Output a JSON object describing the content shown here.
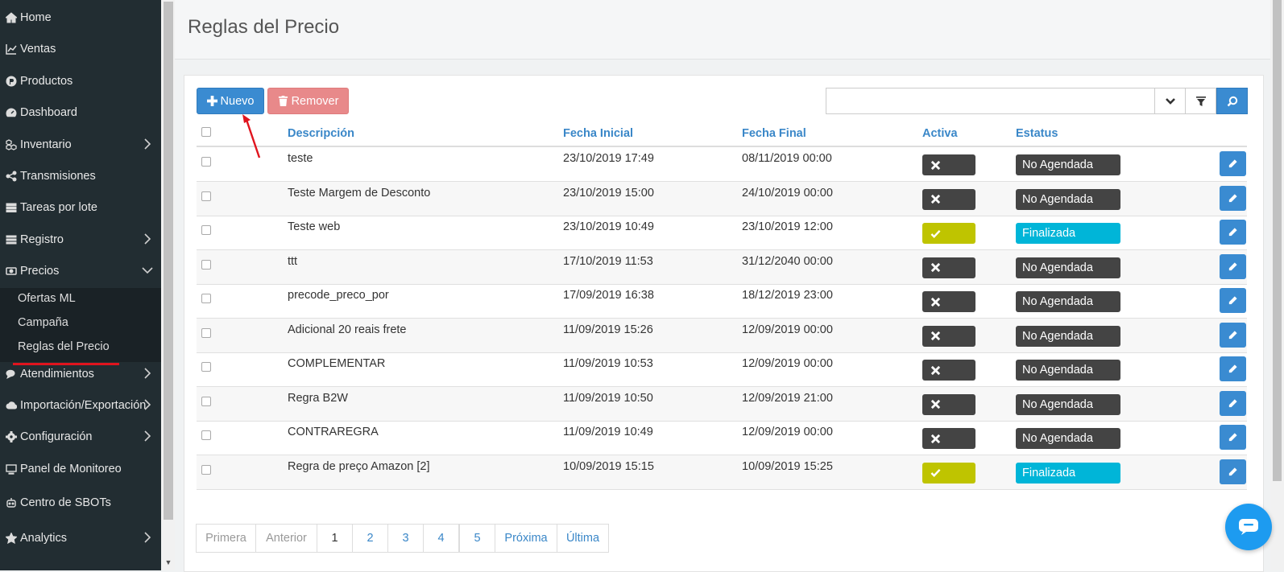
{
  "sidebar": {
    "items": [
      {
        "label": "Home",
        "icon": "home-icon",
        "chevron": false
      },
      {
        "label": "Ventas",
        "icon": "line-chart-icon",
        "chevron": false
      },
      {
        "label": "Productos",
        "icon": "product-icon",
        "chevron": false
      },
      {
        "label": "Dashboard",
        "icon": "dashboard-icon",
        "chevron": false
      },
      {
        "label": "Inventario",
        "icon": "cubes-icon",
        "chevron": true
      },
      {
        "label": "Transmisiones",
        "icon": "share-icon",
        "chevron": false
      },
      {
        "label": "Tareas por lote",
        "icon": "tasks-icon",
        "chevron": false
      },
      {
        "label": "Registro",
        "icon": "list-icon",
        "chevron": true
      },
      {
        "label": "Precios",
        "icon": "money-icon",
        "chevron": true,
        "expanded": true
      },
      {
        "label": "Atendimientos",
        "icon": "comments-icon",
        "chevron": true
      },
      {
        "label": "Importación/Exportación",
        "icon": "cloud-icon",
        "chevron": true
      },
      {
        "label": "Configuración",
        "icon": "gear-icon",
        "chevron": true
      },
      {
        "label": "Panel de Monitoreo",
        "icon": "monitor-icon",
        "chevron": false
      },
      {
        "label": "Centro de SBOTs",
        "icon": "robot-icon",
        "chevron": false
      },
      {
        "label": "Analytics",
        "icon": "star-icon",
        "chevron": true
      }
    ],
    "submenu": [
      "Ofertas ML",
      "Campaña",
      "Reglas del Precio"
    ]
  },
  "page": {
    "title": "Reglas del Precio"
  },
  "toolbar": {
    "new_label": "Nuevo",
    "remove_label": "Remover",
    "search_value": "",
    "search_placeholder": ""
  },
  "table": {
    "headers": {
      "descripcion": "Descripción",
      "fecha_inicial": "Fecha Inicial",
      "fecha_final": "Fecha Final",
      "activa": "Activa",
      "estatus": "Estatus"
    },
    "rows": [
      {
        "descripcion": "teste",
        "fecha_inicial": "23/10/2019 17:49",
        "fecha_final": "08/11/2019 00:00",
        "activa": false,
        "estatus": "No Agendada"
      },
      {
        "descripcion": "Teste Margem de Desconto",
        "fecha_inicial": "23/10/2019 15:00",
        "fecha_final": "24/10/2019 00:00",
        "activa": false,
        "estatus": "No Agendada"
      },
      {
        "descripcion": "Teste web",
        "fecha_inicial": "23/10/2019 10:49",
        "fecha_final": "23/10/2019 12:00",
        "activa": true,
        "estatus": "Finalizada"
      },
      {
        "descripcion": "ttt",
        "fecha_inicial": "17/10/2019 11:53",
        "fecha_final": "31/12/2040 00:00",
        "activa": false,
        "estatus": "No Agendada"
      },
      {
        "descripcion": "precode_preco_por",
        "fecha_inicial": "17/09/2019 16:38",
        "fecha_final": "18/12/2019 23:00",
        "activa": false,
        "estatus": "No Agendada"
      },
      {
        "descripcion": "Adicional 20 reais frete",
        "fecha_inicial": "11/09/2019 15:26",
        "fecha_final": "12/09/2019 00:00",
        "activa": false,
        "estatus": "No Agendada"
      },
      {
        "descripcion": "COMPLEMENTAR",
        "fecha_inicial": "11/09/2019 10:53",
        "fecha_final": "12/09/2019 00:00",
        "activa": false,
        "estatus": "No Agendada"
      },
      {
        "descripcion": "Regra B2W",
        "fecha_inicial": "11/09/2019 10:50",
        "fecha_final": "12/09/2019 21:00",
        "activa": false,
        "estatus": "No Agendada"
      },
      {
        "descripcion": "CONTRAREGRA",
        "fecha_inicial": "11/09/2019 10:49",
        "fecha_final": "12/09/2019 00:00",
        "activa": false,
        "estatus": "No Agendada"
      },
      {
        "descripcion": "Regra de preço Amazon [2]",
        "fecha_inicial": "10/09/2019 15:15",
        "fecha_final": "10/09/2019 15:25",
        "activa": true,
        "estatus": "Finalizada"
      }
    ]
  },
  "pagination": [
    {
      "label": "Primera",
      "state": "disabled"
    },
    {
      "label": "Anterior",
      "state": "disabled"
    },
    {
      "label": "1",
      "state": "active"
    },
    {
      "label": "2",
      "state": "normal"
    },
    {
      "label": "3",
      "state": "normal"
    },
    {
      "label": "4",
      "state": "normal"
    },
    {
      "label": "5",
      "state": "normal"
    },
    {
      "label": "Próxima",
      "state": "normal"
    },
    {
      "label": "Última",
      "state": "normal"
    }
  ],
  "colors": {
    "primary": "#3a8bd1",
    "danger": "#e8898a",
    "active_yes": "#bfc400",
    "active_no": "#444444",
    "status_finalizada": "#00b5d8",
    "status_no": "#444444",
    "sidebar_bg": "#222d32",
    "annotation_red": "#e0141e"
  }
}
